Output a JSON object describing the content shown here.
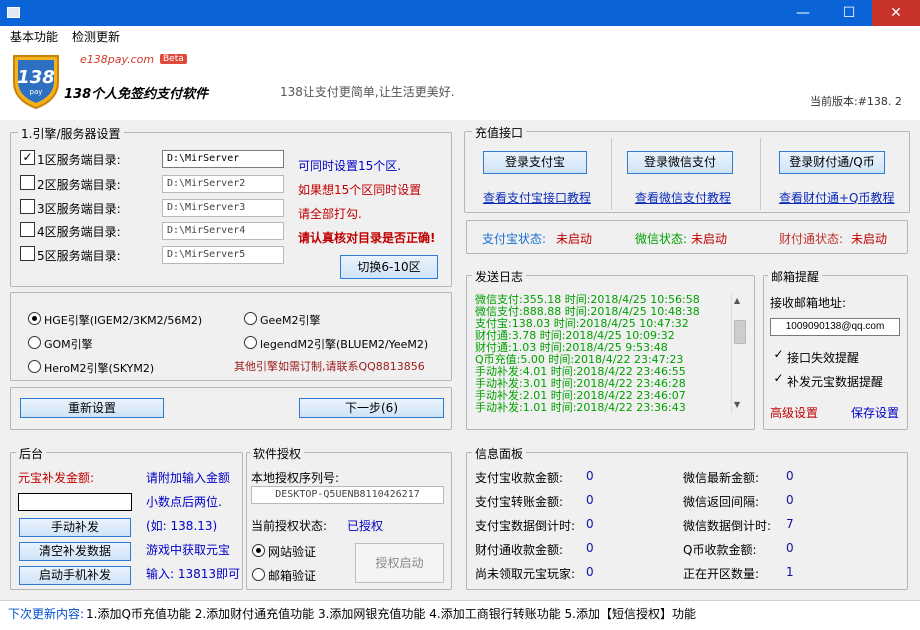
{
  "window": {
    "min": "—",
    "max": "☐",
    "close": "✕"
  },
  "menu": [
    "基本功能",
    "检测更新"
  ],
  "header": {
    "logo_text": "138",
    "logo_sub": "pay",
    "logo_site": "e138pay.com",
    "logo_beta": "Beta",
    "app_title": "138个人免签约支付软件",
    "slogan": "138让支付更简单,让生活更美好.",
    "version": "当前版本:#138. 2"
  },
  "engine": {
    "legend": "1.引擎/服务器设置",
    "servers": [
      {
        "label": "1区服务端目录:",
        "path": "D:\\MirServer",
        "checked": true
      },
      {
        "label": "2区服务端目录:",
        "path": "D:\\MirServer2",
        "checked": false
      },
      {
        "label": "3区服务端目录:",
        "path": "D:\\MirServer3",
        "checked": false
      },
      {
        "label": "4区服务端目录:",
        "path": "D:\\MirServer4",
        "checked": false
      },
      {
        "label": "5区服务端目录:",
        "path": "D:\\MirServer5",
        "checked": false
      }
    ],
    "hints": [
      "可同时设置15个区.",
      "如果想15个区同时设置",
      "请全部打勾.",
      "请认真核对目录是否正确!"
    ],
    "switch_btn": "切换6-10区",
    "engines": [
      "HGE引擎(IGEM2/3KM2/56M2)",
      "GeeM2引擎",
      "GOM引擎",
      "legendM2引擎(BLUEM2/YeeM2)",
      "HeroM2引擎(SKYM2)"
    ],
    "engine_note": "其他引擎如需订制,请联系QQ8813856",
    "reset_btn": "重新设置",
    "next_btn": "下一步(6)"
  },
  "recharge": {
    "legend": "充值接口",
    "alipay_btn": "登录支付宝",
    "wechat_btn": "登录微信支付",
    "tenpay_btn": "登录财付通/Q币",
    "alipay_link": "查看支付宝接口教程",
    "wechat_link": "查看微信支付教程",
    "tenpay_link": "查看财付通+Q币教程",
    "alipay_status_label": "支付宝状态:",
    "alipay_status": "未启动",
    "wechat_status_label": "微信状态:",
    "wechat_status": "未启动",
    "tenpay_status_label": "财付通状态:",
    "tenpay_status": "未启动"
  },
  "log": {
    "legend": "发送日志",
    "lines": [
      "微信支付:355.18 时间:2018/4/25 10:56:58",
      "微信支付:888.88 时间:2018/4/25 10:48:38",
      "支付宝:138.03 时间:2018/4/25 10:47:32",
      "财付通:3.78 时间:2018/4/25 10:09:32",
      "财付通:1.03 时间:2018/4/25 9:53:48",
      "Q币充值:5.00 时间:2018/4/22 23:47:23",
      "手动补发:4.01 时间:2018/4/22 23:46:55",
      "手动补发:3.01 时间:2018/4/22 23:46:28",
      "手动补发:2.01 时间:2018/4/22 23:46:07",
      "手动补发:1.01 时间:2018/4/22 23:36:43"
    ]
  },
  "mail": {
    "legend": "邮箱提醒",
    "address_label": "接收邮箱地址:",
    "address": "1009090138@qq.com",
    "opt1": "接口失效提醒",
    "opt2": "补发元宝数据提醒",
    "advanced": "高级设置",
    "save": "保存设置"
  },
  "backend": {
    "legend": "后台",
    "amount_label": "元宝补发金额:",
    "hint1": "请附加输入金额",
    "hint2": "小数点后两位.",
    "hint3": "(如: 138.13)",
    "hint4": "游戏中获取元宝",
    "hint5": "输入: 13813即可",
    "manual_btn": "手动补发",
    "clear_btn": "清空补发数据",
    "mobile_btn": "启动手机补发"
  },
  "license": {
    "legend": "软件授权",
    "serial_label": "本地授权序列号:",
    "serial": "DESKTOP-Q5UENB8110426217",
    "status_label": "当前授权状态:",
    "status": "已授权",
    "radio_web": "网站验证",
    "radio_mail": "邮箱验证",
    "start_btn": "授权启动"
  },
  "info": {
    "legend": "信息面板",
    "left": [
      {
        "label": "支付宝收款金额:",
        "value": "0"
      },
      {
        "label": "支付宝转账金额:",
        "value": "0"
      },
      {
        "label": "支付宝数据倒计时:",
        "value": "0"
      },
      {
        "label": "财付通收款金额:",
        "value": "0"
      },
      {
        "label": "尚未领取元宝玩家:",
        "value": "0"
      }
    ],
    "right": [
      {
        "label": "微信最新金额:",
        "value": "0"
      },
      {
        "label": "微信返回间隔:",
        "value": "0"
      },
      {
        "label": "微信数据倒计时:",
        "value": "7"
      },
      {
        "label": "Q币收款金额:",
        "value": "0"
      },
      {
        "label": "正在开区数量:",
        "value": "1"
      }
    ]
  },
  "footer": {
    "label": "下次更新内容:",
    "text": "1.添加Q币充值功能 2.添加财付通充值功能 3.添加网银充值功能 4.添加工商银行转账功能 5.添加【短信授权】功能"
  }
}
